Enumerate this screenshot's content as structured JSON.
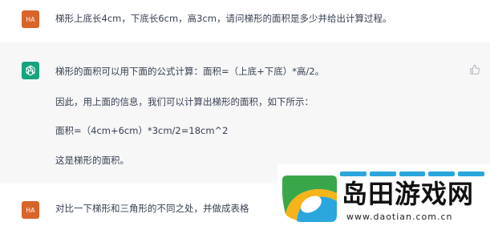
{
  "conversation": {
    "user_message_1": {
      "avatar": "HA",
      "text": "梯形上底长4cm，下底长6cm，高3cm，请问梯形的面积是多少并给出计算过程。"
    },
    "assistant_message": {
      "avatar_icon": "openai-logo-icon",
      "p1": "梯形的面积可以用下面的公式计算：面积=（上底+下底）*高/2。",
      "p2": "因此，用上面的信息，我们可以计算出梯形的面积，如下所示：",
      "p3": "面积=（4cm+6cm）*3cm/2=18cm^2",
      "p4": "这是梯形的面积。",
      "feedback_icon": "thumbs-up-icon"
    },
    "user_message_2": {
      "avatar": "HA",
      "text": "对比一下梯形和三角形的不同之处，并做成表格"
    }
  },
  "watermark": {
    "title": "岛田游戏网",
    "url": "www.daotian.com.cn"
  },
  "colors": {
    "user_avatar": "#d8642a",
    "assistant_avatar": "#16a37f",
    "assistant_row_background": "#f7f7f8",
    "watermark_stripe": "#2aa6dd"
  }
}
